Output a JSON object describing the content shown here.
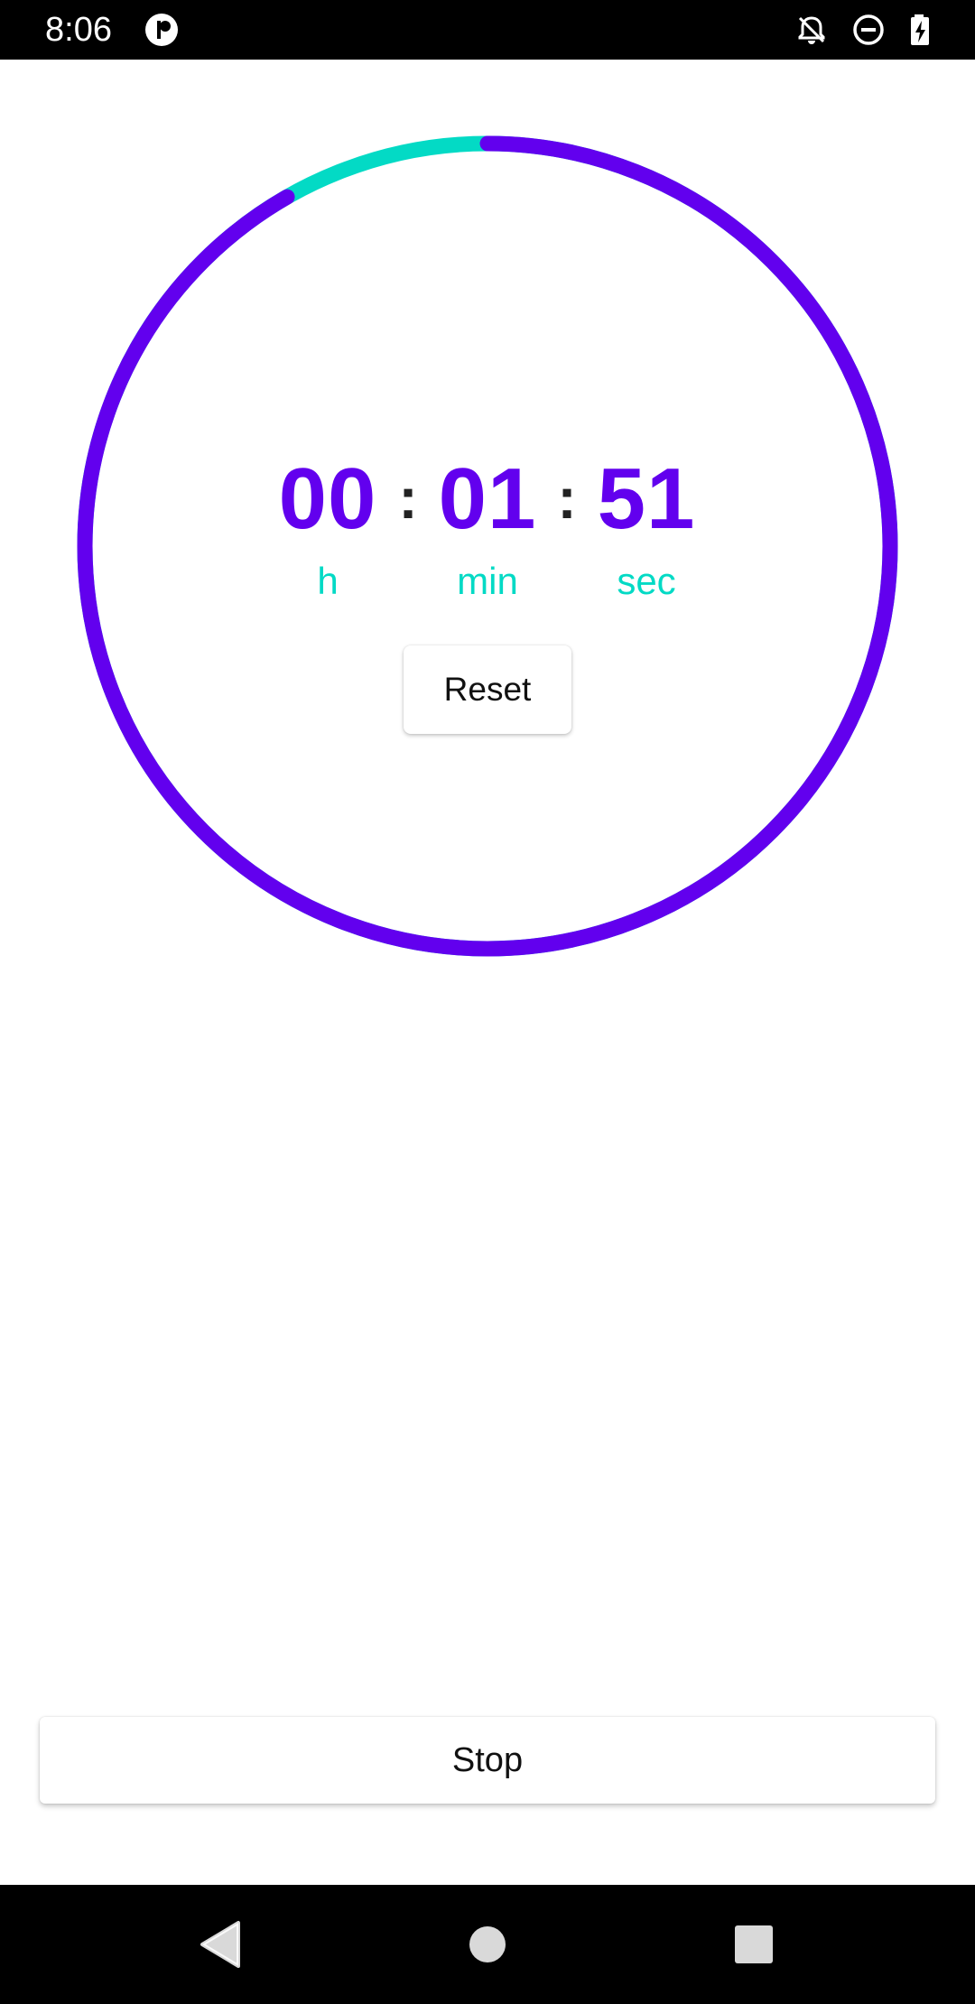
{
  "status_bar": {
    "time": "8:06",
    "icons": [
      "app-notification-icon",
      "notifications-off-icon",
      "do-not-disturb-icon",
      "battery-charging-icon"
    ]
  },
  "timer": {
    "hours": "00",
    "minutes": "01",
    "seconds": "51",
    "separator": ":",
    "hours_unit": "h",
    "minutes_unit": "min",
    "seconds_unit": "sec",
    "progress_fraction": 0.917,
    "progress_color": "#6200EE",
    "remaining_color": "#03DAC5"
  },
  "actions": {
    "reset_label": "Reset",
    "stop_label": "Stop"
  },
  "nav_bar": {
    "buttons": [
      "back-icon",
      "home-icon",
      "recents-icon"
    ]
  },
  "colors": {
    "primary": "#6200EE",
    "accent": "#03DAC5",
    "status_bar": "#000000",
    "nav_bar": "#000000"
  }
}
